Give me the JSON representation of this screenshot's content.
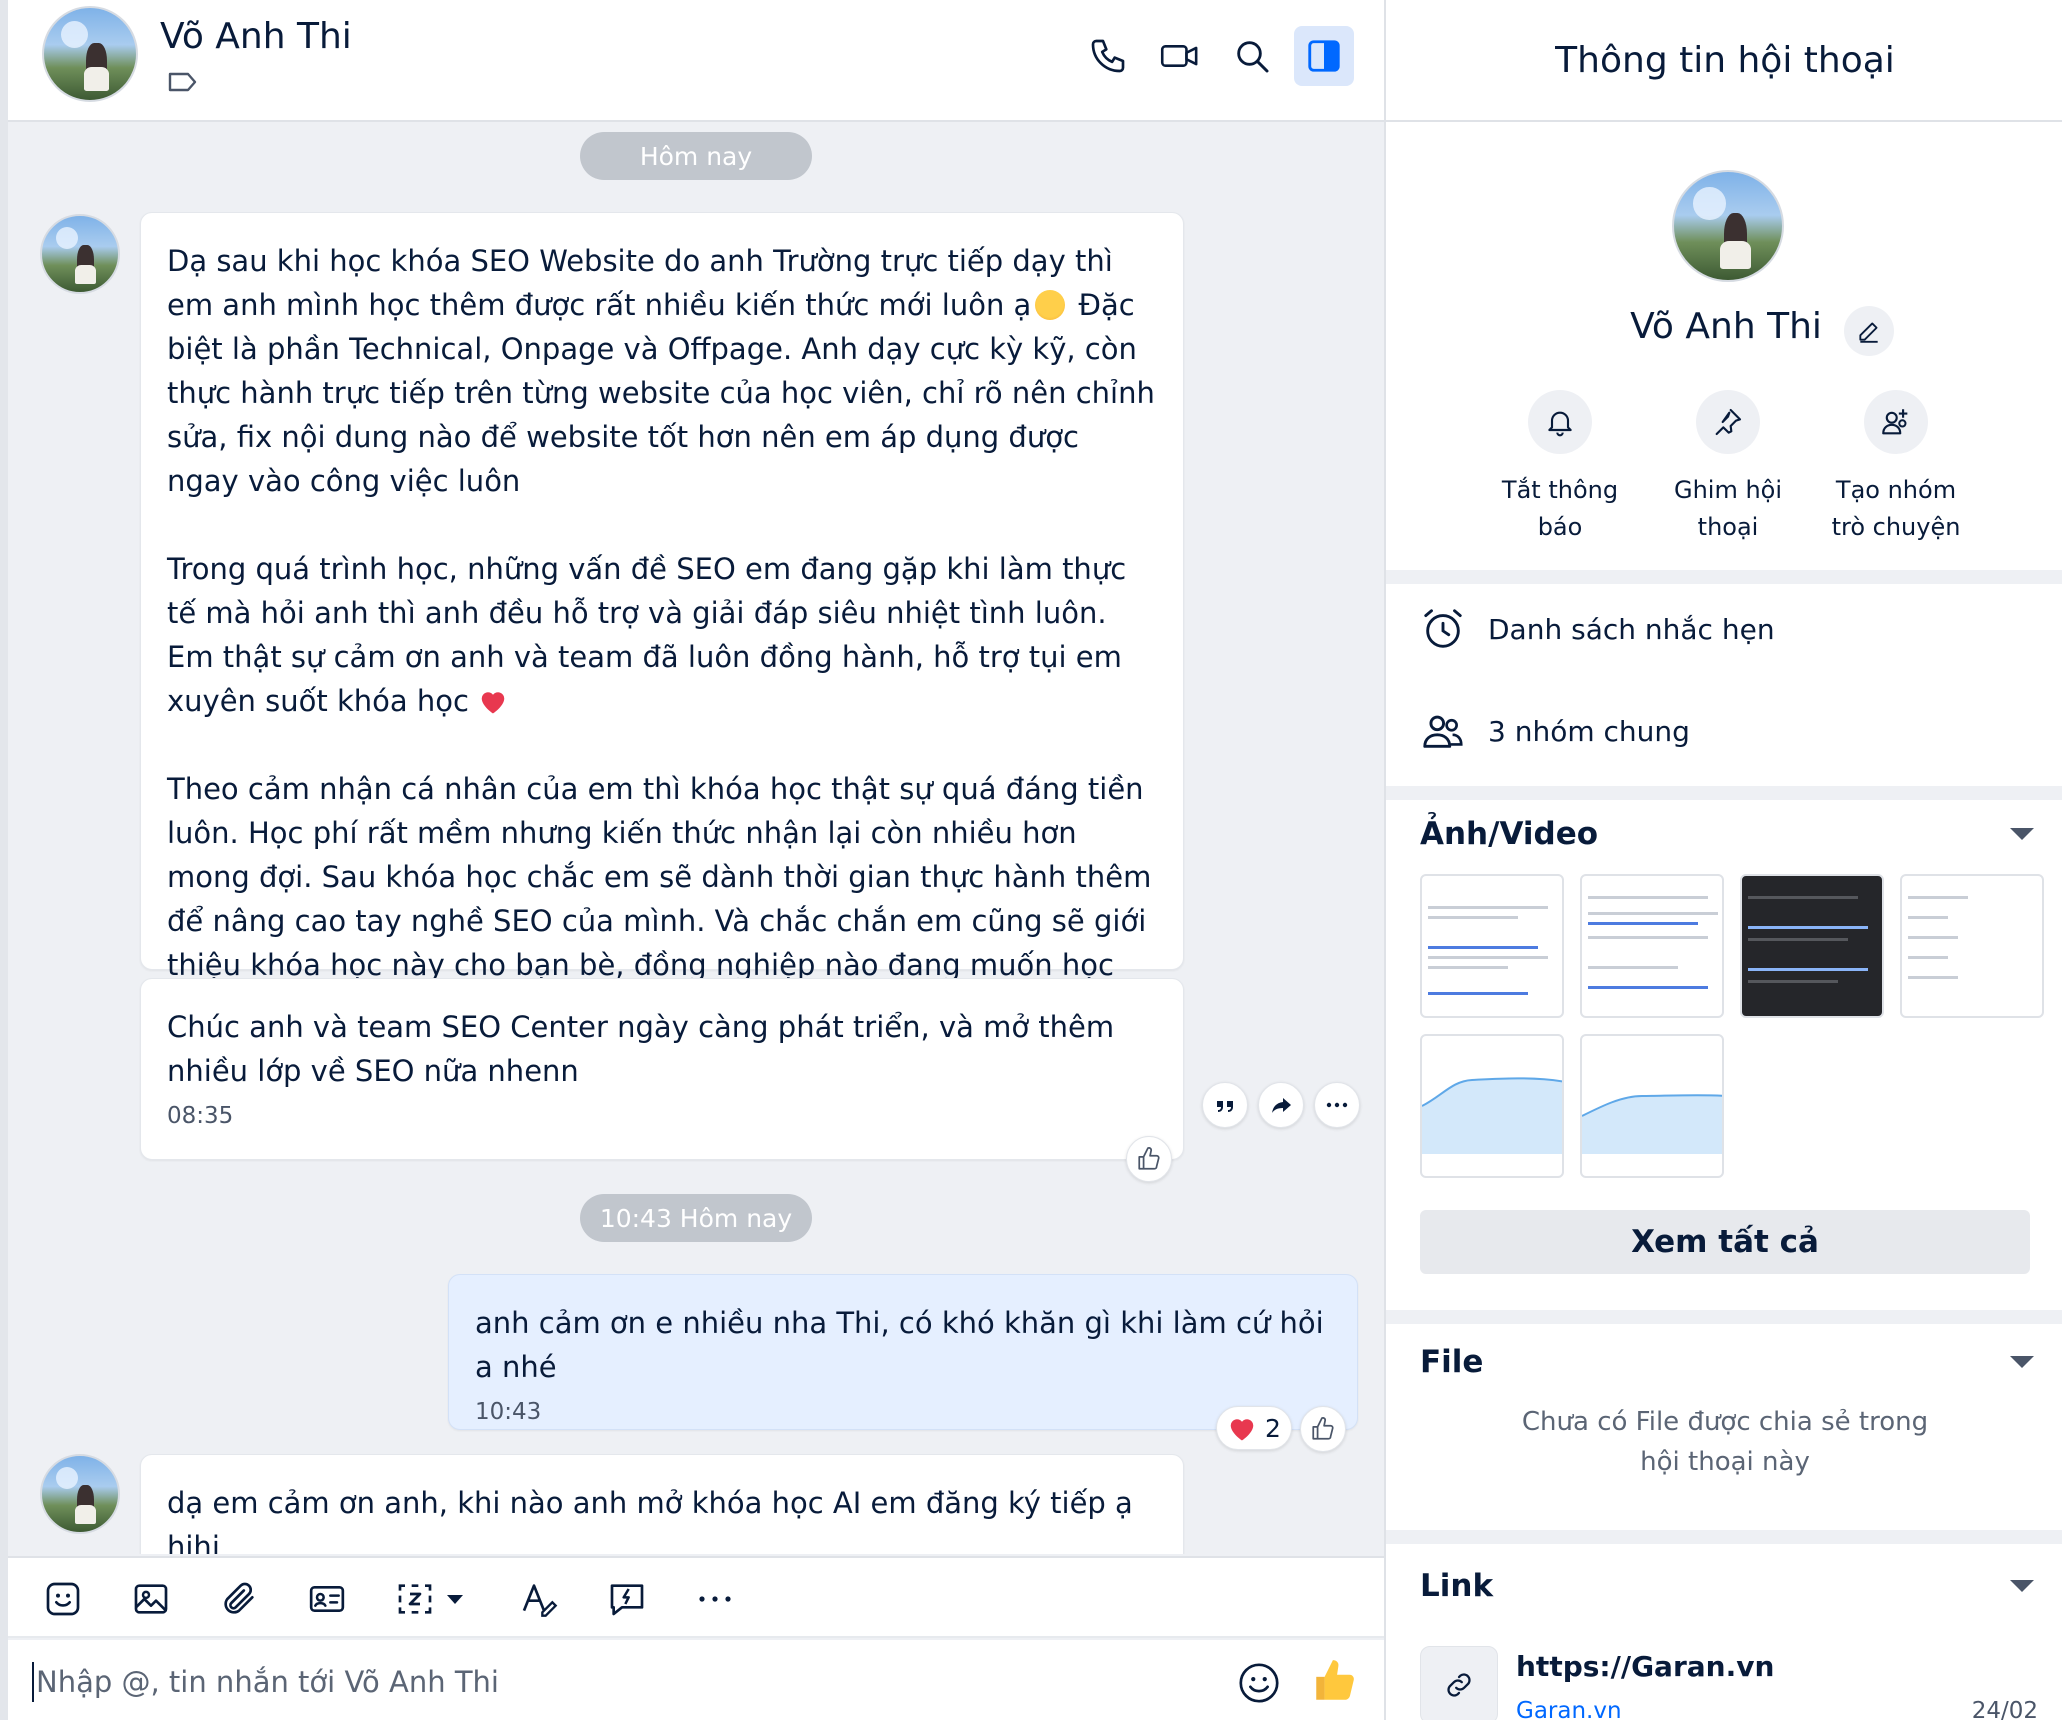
{
  "header": {
    "contact_name": "Võ Anh Thi"
  },
  "messages": {
    "date_separator_1": "Hôm nay",
    "msg1": {
      "text": "Dạ sau khi học khóa SEO Website do anh Trường trực tiếp dạy thì em anh mình học thêm được rất nhiều kiến thức mới luôn ạ",
      "text_b": " Đặc biệt là phần Technical, Onpage và Offpage. Anh dạy cực kỳ kỹ, còn thực hành trực tiếp trên từng website của học viên, chỉ rõ nên chỉnh sửa, fix nội dung nào để website tốt hơn nên em áp dụng được ngay vào công việc luôn",
      "text_c": "Trong quá trình học, những vấn đề SEO em đang gặp khi làm thực tế mà hỏi anh thì anh đều hỗ trợ và giải đáp siêu nhiệt tình luôn. Em thật sự cảm ơn anh và team đã luôn đồng hành, hỗ trợ tụi em xuyên suốt khóa học",
      "text_d": "Theo cảm nhận cá nhân của em thì khóa học thật sự quá đáng tiền luôn. Học phí rất mềm nhưng kiến thức nhận lại còn nhiều hơn mong đợi. Sau khóa học chắc em sẽ dành thời gian thực hành thêm để nâng cao tay nghề SEO của mình. Và chắc chắn em cũng sẽ giới thiệu khóa học này cho bạn bè, đồng nghiệp nào đang muốn học SEO luôn ạ"
    },
    "msg2": {
      "text": "Chúc anh và team SEO Center ngày càng phát triển, và mở thêm nhiều lớp về SEO nữa nhenn",
      "time": "08:35"
    },
    "date_separator_2": "10:43 Hôm nay",
    "msg3": {
      "text": "anh cảm ơn e nhiều nha Thi, có khó khăn gì khi làm cứ hỏi a nhé",
      "time": "10:43",
      "reaction_count": "2"
    },
    "msg4": {
      "text": "dạ em cảm ơn anh, khi nào anh mở khóa học AI em đăng ký tiếp ạ hihi"
    }
  },
  "composer": {
    "placeholder": "Nhập @, tin nhắn tới Võ Anh Thi"
  },
  "panel": {
    "title": "Thông tin hội thoại",
    "name": "Võ Anh Thi",
    "actions": {
      "mute": "Tắt thông\nbáo",
      "pin": "Ghim hội\nthoại",
      "create_group": "Tạo nhóm\ntrò chuyện"
    },
    "reminders": "Danh sách nhắc hẹn",
    "common_groups": "3 nhóm chung",
    "media_title": "Ảnh/Video",
    "see_all": "Xem tất cả",
    "file_title": "File",
    "file_empty": "Chưa có File được chia sẻ trong\nhội thoại này",
    "link_title": "Link",
    "link": {
      "title": "https://Garan.vn",
      "domain": "Garan.vn",
      "date": "24/02"
    }
  },
  "colors": {
    "accent": "#0068ff",
    "bubble_mine": "#e5efff",
    "chat_bg": "#eef0f4",
    "heart": "#e8384f"
  }
}
